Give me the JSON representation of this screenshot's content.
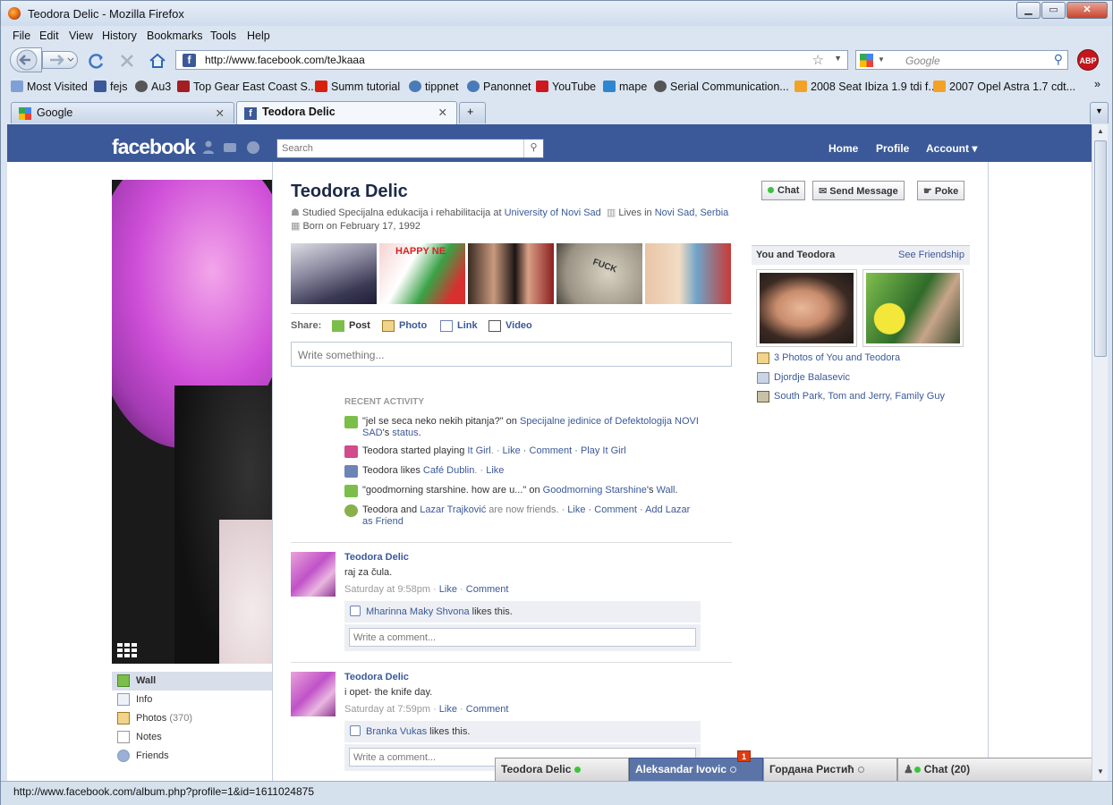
{
  "window": {
    "title": "Teodora Delic - Mozilla Firefox"
  },
  "menu": [
    "File",
    "Edit",
    "View",
    "History",
    "Bookmarks",
    "Tools",
    "Help"
  ],
  "nav": {
    "url": "http://www.facebook.com/teJkaaa",
    "search_placeholder": "Google"
  },
  "bookmarks": [
    "Most Visited",
    "fejs",
    "Au3",
    "Top Gear East Coast S...",
    "Summ tutorial",
    "tippnet",
    "Panonnet",
    "YouTube",
    "mape",
    "Serial Communication...",
    "2008 Seat Ibiza 1.9 tdi f...",
    "2007 Opel Astra 1.7 cdt..."
  ],
  "tabs": [
    {
      "label": "Google"
    },
    {
      "label": "Teodora Delic"
    }
  ],
  "status": "http://www.facebook.com/album.php?profile=1&id=1611024875",
  "fb": {
    "logo": "facebook",
    "search_placeholder": "Search",
    "nav": [
      "Home",
      "Profile",
      "Account ▾"
    ],
    "profile_name": "Teodora Delic",
    "info_studied_prefix": "Studied Specijalna edukacija i rehabilitacija at ",
    "info_studied_link": "University of Novi Sad",
    "info_lives_prefix": "Lives in ",
    "info_lives_link": "Novi Sad, Serbia",
    "info_born": "Born on February 17, 1992",
    "actions": [
      "Chat",
      "Send Message",
      "Poke"
    ],
    "left_nav": [
      {
        "label": "Wall"
      },
      {
        "label": "Info"
      },
      {
        "label": "Photos",
        "count": "(370)"
      },
      {
        "label": "Notes"
      },
      {
        "label": "Friends"
      }
    ],
    "share": {
      "label": "Share:",
      "items": [
        "Post",
        "Photo",
        "Link",
        "Video"
      ],
      "placeholder": "Write something..."
    },
    "recent_activity": {
      "title": "RECENT ACTIVITY",
      "items": [
        {
          "pre": "\"jel se seca neko nekih pitanja?\" on ",
          "link": "Specijalne jedinice of Defektologija NOVI SAD",
          "post": "'s ",
          "link2": "status",
          "end": "."
        },
        {
          "pre": "Teodora started playing ",
          "link": "It Girl",
          "post": ". · ",
          "actions": "Like · Comment · Play It Girl"
        },
        {
          "pre": "Teodora likes ",
          "link": "Café Dublin",
          "post": ". · ",
          "actions": "Like"
        },
        {
          "pre": "\"goodmorning starshine. how are u...\" on ",
          "link": "Goodmorning Starshine",
          "post": "'s ",
          "link2": "Wall",
          "end": "."
        },
        {
          "pre": "Teodora and ",
          "link": "Lazar Trajković",
          "post": " are now friends. · ",
          "actions": "Like · Comment · Add Lazar as Friend"
        }
      ]
    },
    "posts": [
      {
        "author": "Teodora Delic",
        "text": "raj za čula.",
        "time": "Saturday at 9:58pm",
        "like": "Like",
        "comment": "Comment",
        "liker": "Mharinna Maky Shvona",
        "likes_suffix": " likes this.",
        "comment_placeholder": "Write a comment..."
      },
      {
        "author": "Teodora Delic",
        "text": "i opet- the knife day.",
        "time": "Saturday at 7:59pm",
        "like": "Like",
        "comment": "Comment",
        "liker": "Branka Vukas",
        "likes_suffix": " likes this.",
        "comment_placeholder": "Write a comment..."
      }
    ],
    "you_and": {
      "title": "You and Teodora",
      "see": "See Friendship",
      "links": [
        "3 Photos of You and Teodora",
        "Djordje Balasevic"
      ],
      "shows": [
        "South Park",
        "Tom and Jerry",
        "Family Guy"
      ]
    },
    "chat": {
      "tabs": [
        {
          "name": "Teodora Delic",
          "color": "#3ec23e"
        },
        {
          "name": "Aleksandar Ivovic",
          "color": "#ffffff"
        },
        {
          "name": "Гордана Ристић",
          "color": "#ffffff"
        }
      ],
      "badge": "1",
      "main": "Chat (20)"
    }
  }
}
